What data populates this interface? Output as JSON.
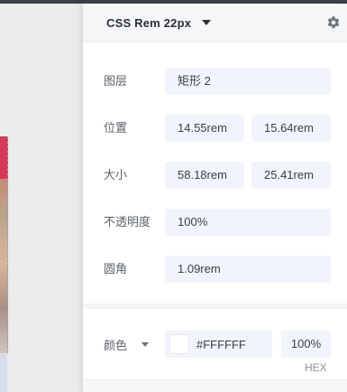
{
  "header": {
    "unit_label": "CSS Rem 22px"
  },
  "properties": {
    "layer": {
      "label": "图层",
      "value": "矩形 2"
    },
    "position": {
      "label": "位置",
      "x": "14.55rem",
      "y": "15.64rem"
    },
    "size": {
      "label": "大小",
      "width": "58.18rem",
      "height": "25.41rem"
    },
    "opacity": {
      "label": "不透明度",
      "value": "100%"
    },
    "radius": {
      "label": "圆角",
      "value": "1.09rem"
    }
  },
  "color": {
    "label": "颜色",
    "hex": "#FFFFFF",
    "alpha": "100%",
    "format": "HEX",
    "swatch": "#FFFFFF"
  },
  "icons": {
    "unit_dropdown": "caret-down-icon",
    "settings": "gear-icon",
    "color_mode_dropdown": "caret-down-icon"
  },
  "colors": {
    "field_bg": "#f1f4fa",
    "header_bg": "#f5f6f8",
    "accent_artboard": "#d23a57"
  }
}
